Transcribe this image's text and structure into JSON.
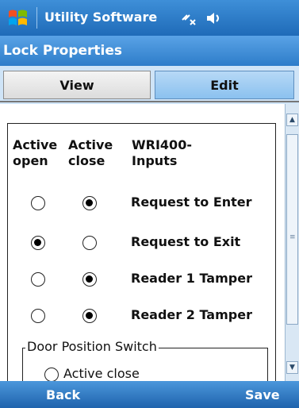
{
  "title_bar": {
    "app_title": "Utility Software",
    "icons": [
      "windows-start-icon",
      "signal-icon",
      "volume-icon"
    ]
  },
  "header": {
    "title": "Lock Properties"
  },
  "tabs": [
    {
      "label": "View",
      "selected": false
    },
    {
      "label": "Edit",
      "selected": true
    }
  ],
  "table": {
    "headers": {
      "open": [
        "Active",
        "open"
      ],
      "close": [
        "Active",
        "close"
      ],
      "inputs": [
        "WRI400-",
        "Inputs"
      ]
    },
    "rows": [
      {
        "label": "Request to Enter",
        "active_open": false,
        "active_close": true
      },
      {
        "label": "Request to Exit",
        "active_open": true,
        "active_close": false
      },
      {
        "label": "Reader 1 Tamper",
        "active_open": false,
        "active_close": true
      },
      {
        "label": "Reader 2 Tamper",
        "active_open": false,
        "active_close": true
      }
    ]
  },
  "door_position_switch": {
    "title": "Door Position Switch",
    "options": [
      {
        "label": "Active close",
        "selected": false
      }
    ]
  },
  "softkeys": {
    "left": "Back",
    "right": "Save"
  },
  "colors": {
    "title_bar": "#1f6bb8",
    "header": "#2d7cc9",
    "selected_tab": "#8bc1ef",
    "softkey_bar": "#1f63ad"
  }
}
